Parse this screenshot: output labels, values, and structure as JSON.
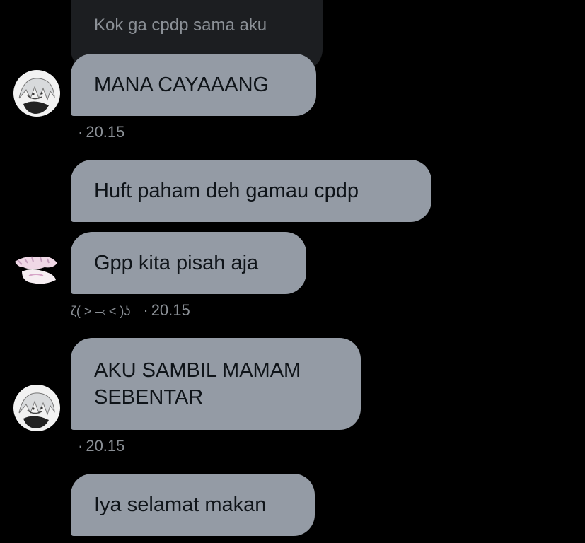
{
  "conversation": {
    "quoted_reply": {
      "text": "Kok ga cpdp sama aku"
    },
    "messages": [
      {
        "text": "MANA CAYAAANG",
        "time": "20.15"
      },
      {
        "text": "Huft paham deh gamau cpdp"
      },
      {
        "text": "Gpp kita pisah aja",
        "sender": "ζ( ˃ ⤙ ˂ )ʖ",
        "time": "20.15"
      },
      {
        "text_line1": "AKU SAMBIL MAMAM",
        "text_line2": "SEBENTAR",
        "time": "20.15"
      },
      {
        "text": "Iya selamat makan"
      }
    ],
    "separator": "·"
  },
  "theme": {
    "background": "#000000",
    "received_bubble": "#949ba5",
    "quoted_bubble": "#1c1e21",
    "meta_text": "#8b9096"
  },
  "icons": [
    "avatar-anime-boy",
    "avatar-sticker-collage"
  ]
}
